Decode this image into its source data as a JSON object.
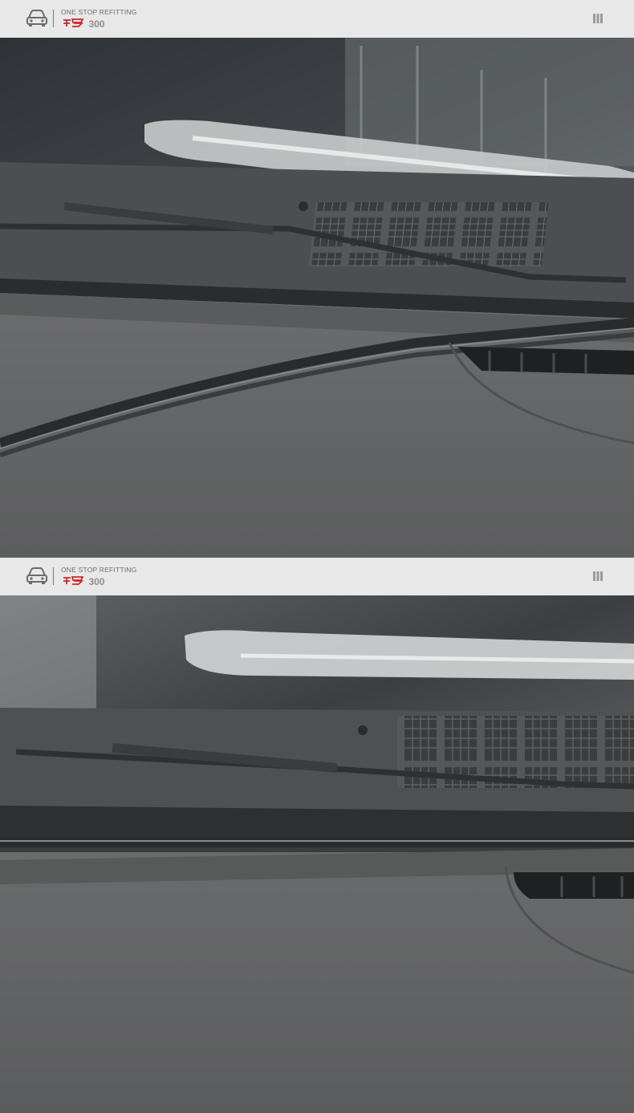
{
  "panels": [
    {
      "header": {
        "tagline": "ONE STOP REFITTING",
        "brand_mark": "坦克",
        "brand_model": "300",
        "icons": {
          "logo": "car-front-icon",
          "menu": "menu-icon"
        }
      },
      "photo": {
        "subject": "windshield-dashboard-seal"
      }
    },
    {
      "header": {
        "tagline": "ONE STOP REFITTING",
        "brand_mark": "坦克",
        "brand_model": "300",
        "icons": {
          "logo": "car-front-icon",
          "menu": "menu-icon"
        }
      },
      "photo": {
        "subject": "windshield-dashboard-seal"
      }
    }
  ],
  "colors": {
    "header_bg": "#e8e8e8",
    "brand_red": "#d0262a",
    "text_grey": "#6d6d6d",
    "dashboard": "#5e5f60",
    "glass": "#3c3f42"
  }
}
